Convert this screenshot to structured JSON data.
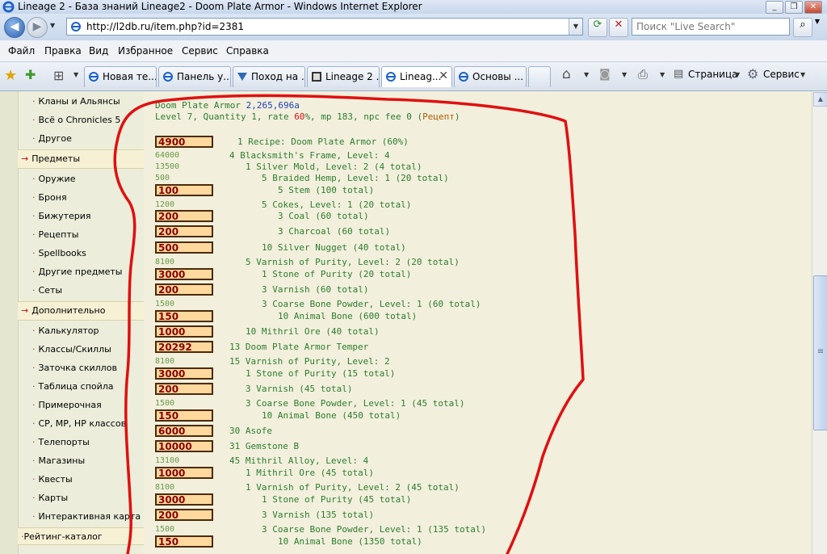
{
  "window": {
    "title": "Lineage 2 - База знаний Lineage2 - Doom Plate Armor - Windows Internet Explorer"
  },
  "address": {
    "url": "http://l2db.ru/item.php?id=2381",
    "search_placeholder": "Поиск \"Live Search\""
  },
  "menu": [
    "Файл",
    "Правка",
    "Вид",
    "Избранное",
    "Сервис",
    "Справка"
  ],
  "tabs": [
    {
      "label": "Новая те..."
    },
    {
      "label": "Панель у..."
    },
    {
      "label": "Поход на ..."
    },
    {
      "label": "Lineage 2 ..."
    },
    {
      "label": "Lineag..."
    },
    {
      "label": "Основы ..."
    }
  ],
  "commands": {
    "page": "Страница",
    "tools": "Сервис"
  },
  "nav": {
    "top_items": [
      "Кланы и Альянсы",
      "Всё о Chronicles 5",
      "Другое"
    ],
    "section_items": "Предметы",
    "items": [
      "Оружие",
      "Броня",
      "Бижутерия",
      "Рецепты",
      "Spellbooks",
      "Другие предметы",
      "Сеты"
    ],
    "section_extra": "Дополнительно",
    "extra": [
      "Калькулятор",
      "Классы/Скиллы",
      "Заточка скиллов",
      "Таблица спойла",
      "Примерочная",
      "CP, MP, HP классов",
      "Телепорты",
      "Магазины",
      "Квесты",
      "Карты",
      "Интерактивная карта"
    ],
    "section_rating": "Рейтинг-каталог"
  },
  "item": {
    "name": "Doom Plate Armor",
    "price": "2,265,696a",
    "stats_pre": "Level 7, Quantity 1, rate ",
    "rate": "60",
    "stats_post": "%, mp 183, npc fee 0 (",
    "recipe_word": "Рецепт",
    "close_paren": ")"
  },
  "rows": [
    {
      "price": "4900",
      "boxed": true,
      "text": "1 Recipe: Doom Plate Armor (60%)",
      "indent": 1
    },
    {
      "price": "64000",
      "boxed": false,
      "text": "4 Blacksmith's Frame, Level: 4",
      "indent": 0
    },
    {
      "price": "13500",
      "boxed": false,
      "text": "1 Silver Mold, Level: 2 (4 total)",
      "indent": 2
    },
    {
      "price": "500",
      "boxed": false,
      "text": "5 Braided Hemp, Level: 1 (20 total)",
      "indent": 4
    },
    {
      "price": "100",
      "boxed": true,
      "text": "5 Stem (100 total)",
      "indent": 6
    },
    {
      "price": "1200",
      "boxed": false,
      "text": "5 Cokes, Level: 1 (20 total)",
      "indent": 4
    },
    {
      "price": "200",
      "boxed": true,
      "text": "3 Coal (60 total)",
      "indent": 6
    },
    {
      "price": "200",
      "boxed": true,
      "text": "3 Charcoal (60 total)",
      "indent": 6
    },
    {
      "price": "500",
      "boxed": true,
      "text": "10 Silver Nugget (40 total)",
      "indent": 4
    },
    {
      "price": "8100",
      "boxed": false,
      "text": "5 Varnish of Purity, Level: 2 (20 total)",
      "indent": 2
    },
    {
      "price": "3000",
      "boxed": true,
      "text": "1 Stone of Purity (20 total)",
      "indent": 4
    },
    {
      "price": "200",
      "boxed": true,
      "text": "3 Varnish (60 total)",
      "indent": 4
    },
    {
      "price": "1500",
      "boxed": false,
      "text": "3 Coarse Bone Powder, Level: 1 (60 total)",
      "indent": 4
    },
    {
      "price": "150",
      "boxed": true,
      "text": "10 Animal Bone (600 total)",
      "indent": 6
    },
    {
      "price": "1000",
      "boxed": true,
      "text": "10 Mithril Ore (40 total)",
      "indent": 2
    },
    {
      "price": "20292",
      "boxed": true,
      "text": "13 Doom Plate Armor Temper",
      "indent": 0
    },
    {
      "price": "8100",
      "boxed": false,
      "text": "15 Varnish of Purity, Level: 2",
      "indent": 0
    },
    {
      "price": "3000",
      "boxed": true,
      "text": "1 Stone of Purity (15 total)",
      "indent": 2
    },
    {
      "price": "200",
      "boxed": true,
      "text": "3 Varnish (45 total)",
      "indent": 2
    },
    {
      "price": "1500",
      "boxed": false,
      "text": "3 Coarse Bone Powder, Level: 1 (45 total)",
      "indent": 2
    },
    {
      "price": "150",
      "boxed": true,
      "text": "10 Animal Bone (450 total)",
      "indent": 4
    },
    {
      "price": "6000",
      "boxed": true,
      "text": "30 Asofe",
      "indent": 0
    },
    {
      "price": "10000",
      "boxed": true,
      "text": "31 Gemstone B",
      "indent": 0
    },
    {
      "price": "13100",
      "boxed": false,
      "text": "45 Mithril Alloy, Level: 4",
      "indent": 0
    },
    {
      "price": "1000",
      "boxed": true,
      "text": "1 Mithril Ore (45 total)",
      "indent": 2
    },
    {
      "price": "8100",
      "boxed": false,
      "text": "1 Varnish of Purity, Level: 2 (45 total)",
      "indent": 2
    },
    {
      "price": "3000",
      "boxed": true,
      "text": "1 Stone of Purity (45 total)",
      "indent": 4
    },
    {
      "price": "200",
      "boxed": true,
      "text": "3 Varnish (135 total)",
      "indent": 4
    },
    {
      "price": "1500",
      "boxed": false,
      "text": "3 Coarse Bone Powder, Level: 1 (135 total)",
      "indent": 4
    },
    {
      "price": "150",
      "boxed": true,
      "text": "10 Animal Bone (1350 total)",
      "indent": 6
    }
  ],
  "colors": {
    "annotation": "#e01010",
    "price_box": "#ffd89e",
    "item_text": "#2e7d2e",
    "header_text": "#2d7a2d",
    "price_text": "#1f3fbf"
  }
}
